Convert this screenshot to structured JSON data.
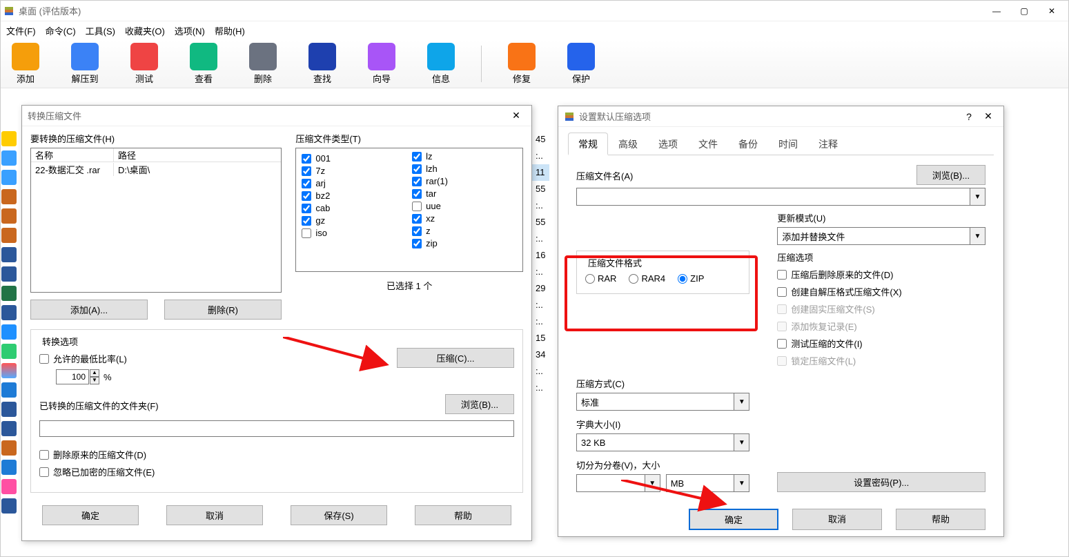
{
  "main_window": {
    "title": "桌面 (评估版本)",
    "menus": [
      "文件(F)",
      "命令(C)",
      "工具(S)",
      "收藏夹(O)",
      "选项(N)",
      "帮助(H)"
    ],
    "toolbar_left": [
      {
        "label": "添加",
        "color": "#f59e0b"
      },
      {
        "label": "解压到",
        "color": "#3b82f6"
      },
      {
        "label": "测试",
        "color": "#ef4444"
      },
      {
        "label": "查看",
        "color": "#10b981"
      },
      {
        "label": "删除",
        "color": "#6b7280"
      },
      {
        "label": "查找",
        "color": "#1e40af"
      },
      {
        "label": "向导",
        "color": "#a855f7"
      },
      {
        "label": "信息",
        "color": "#0ea5e9"
      }
    ],
    "toolbar_right": [
      {
        "label": "修复",
        "color": "#f97316"
      },
      {
        "label": "保护",
        "color": "#2563eb"
      }
    ],
    "bg_rows": [
      "45",
      ":..",
      "11",
      "55",
      ":..",
      "55",
      ":..",
      "16",
      ":..",
      "29",
      ":..",
      ":..",
      "15",
      "34",
      ":..",
      ":.."
    ],
    "bg_selected_index": 2
  },
  "convert_dlg": {
    "title": "转换压缩文件",
    "label_archives": "要转换的压缩文件(H)",
    "label_types": "压缩文件类型(T)",
    "col_name": "名称",
    "col_path": "路径",
    "row0_name": "22-数据汇交 .rar",
    "row0_path": "D:\\桌面\\",
    "types_left": [
      {
        "l": "001",
        "c": true
      },
      {
        "l": "7z",
        "c": true
      },
      {
        "l": "arj",
        "c": true
      },
      {
        "l": "bz2",
        "c": true
      },
      {
        "l": "cab",
        "c": true
      },
      {
        "l": "gz",
        "c": true
      },
      {
        "l": "iso",
        "c": false
      },
      {
        "l": "lz",
        "c": true
      }
    ],
    "types_right": [
      {
        "l": "lzh",
        "c": true
      },
      {
        "l": "rar(1)",
        "c": true
      },
      {
        "l": "tar",
        "c": true
      },
      {
        "l": "uue",
        "c": false
      },
      {
        "l": "xz",
        "c": true
      },
      {
        "l": "z",
        "c": true
      },
      {
        "l": "zip",
        "c": true
      }
    ],
    "add_btn": "添加(A)...",
    "remove_btn": "删除(R)",
    "selected_count": "已选择 1 个",
    "options_legend": "转换选项",
    "allow_lowest": "允许的最低比率(L)",
    "ratio_value": "100",
    "percent": "%",
    "compress_btn": "压缩(C)...",
    "folder_label": "已转换的压缩文件的文件夹(F)",
    "browse_btn": "浏览(B)...",
    "delete_original": "删除原来的压缩文件(D)",
    "skip_encrypted": "忽略已加密的压缩文件(E)",
    "ok": "确定",
    "cancel": "取消",
    "save": "保存(S)",
    "help": "帮助"
  },
  "defaults_dlg": {
    "title": "设置默认压缩选项",
    "tabs": [
      "常规",
      "高级",
      "选项",
      "文件",
      "备份",
      "时间",
      "注释"
    ],
    "active_tab": 0,
    "archive_name_label": "压缩文件名(A)",
    "browse": "浏览(B)...",
    "update_mode_label": "更新模式(U)",
    "update_mode_value": "添加并替换文件",
    "format_legend": "压缩文件格式",
    "formats": [
      "RAR",
      "RAR4",
      "ZIP"
    ],
    "format_selected": 2,
    "comp_options_legend": "压缩选项",
    "opts": [
      {
        "l": "压缩后删除原来的文件(D)",
        "en": true
      },
      {
        "l": "创建自解压格式压缩文件(X)",
        "en": true
      },
      {
        "l": "创建固实压缩文件(S)",
        "en": false
      },
      {
        "l": "添加恢复记录(E)",
        "en": false
      },
      {
        "l": "测试压缩的文件(I)",
        "en": true
      },
      {
        "l": "锁定压缩文件(L)",
        "en": false
      }
    ],
    "method_label": "压缩方式(C)",
    "method_value": "标准",
    "dict_label": "字典大小(I)",
    "dict_value": "32 KB",
    "split_label": "切分为分卷(V)，大小",
    "split_unit": "MB",
    "password_btn": "设置密码(P)...",
    "ok": "确定",
    "cancel": "取消",
    "help": "帮助"
  }
}
